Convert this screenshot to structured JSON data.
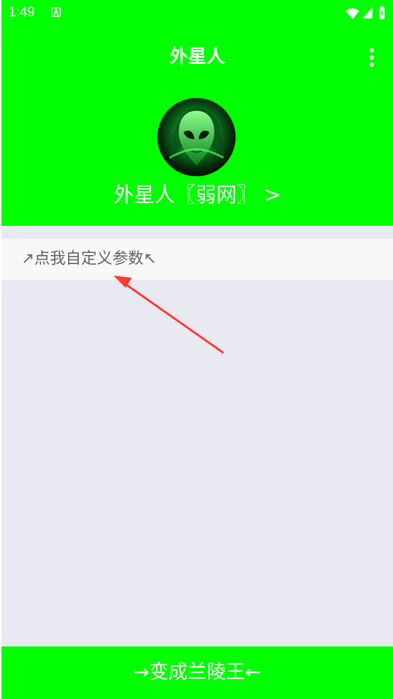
{
  "status_bar": {
    "time": "1:49",
    "left_icon": "a-icon",
    "right_icons": [
      "wifi-icon",
      "signal-icon",
      "battery-icon"
    ]
  },
  "header": {
    "title": "外星人",
    "menu_icon": "more-vert-icon",
    "avatar_icon": "alien-avatar-icon",
    "profile_name": "外星人〖弱网〗 >"
  },
  "main": {
    "param_label": "↗点我自定义参数↖",
    "annotation_icon": "red-arrow-icon"
  },
  "footer": {
    "button_label": "→变成兰陵王←"
  },
  "colors": {
    "accent_green": "#00ff00",
    "content_bg": "#e9e9f1",
    "row_bg": "#f8f8f8",
    "text_gray": "#666666",
    "annotation_red": "#ff3b30"
  }
}
